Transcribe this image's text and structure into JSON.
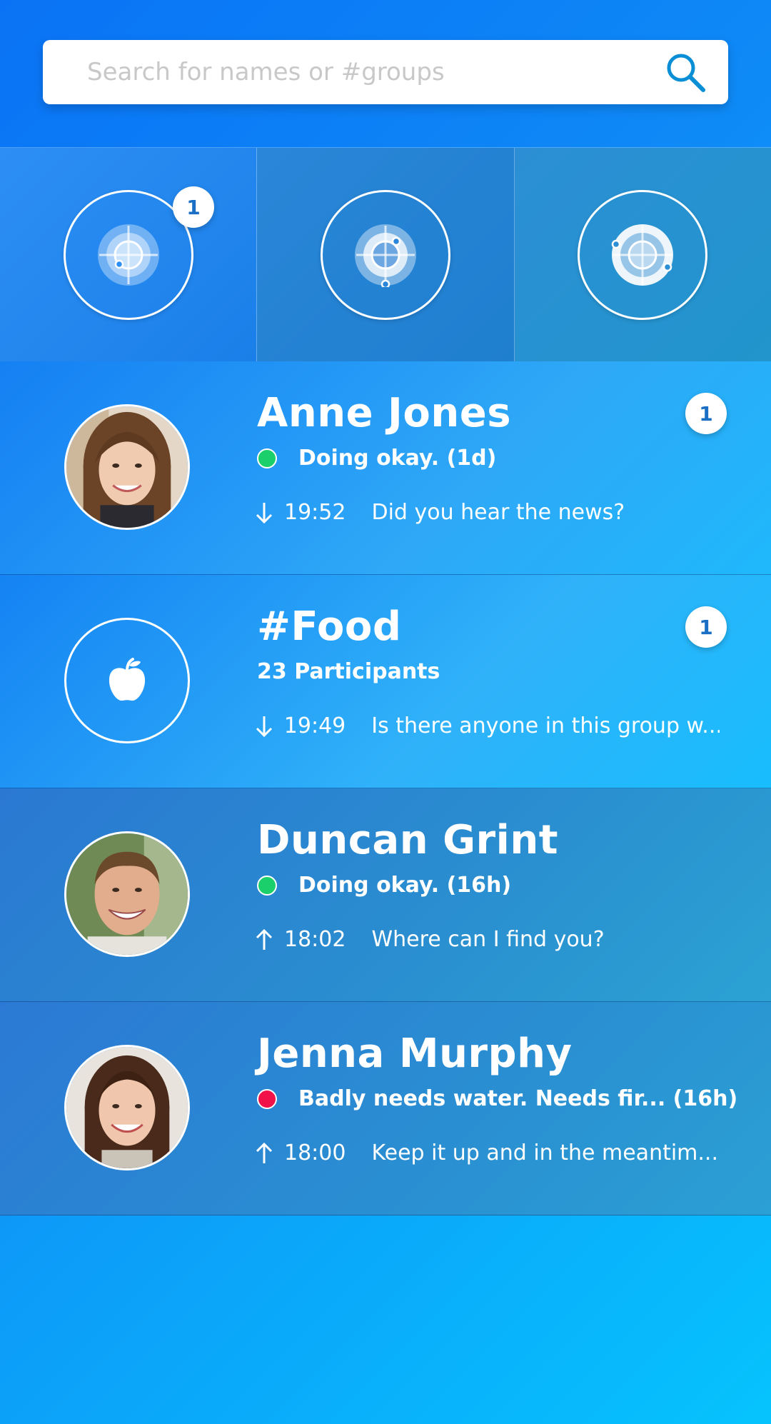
{
  "search": {
    "placeholder": "Search for names or #groups",
    "value": ""
  },
  "tabs": [
    {
      "icon": "radar-icon",
      "badge": "1",
      "active": true
    },
    {
      "icon": "radar-icon",
      "badge": ""
    },
    {
      "icon": "radar-icon",
      "badge": ""
    }
  ],
  "conversations": [
    {
      "type": "person",
      "name": "Anne Jones",
      "status_color": "#1bd06a",
      "status": "Doing okay. (1d)",
      "direction": "incoming",
      "time": "19:52",
      "preview": "Did you hear the news?",
      "badge": "1"
    },
    {
      "type": "group",
      "name": "#Food",
      "icon": "apple-icon",
      "participants": "23 Participants",
      "direction": "incoming",
      "time": "19:49",
      "preview": "Is there anyone in this group w...",
      "badge": "1"
    },
    {
      "type": "person",
      "name": "Duncan Grint",
      "status_color": "#1bd06a",
      "status": "Doing okay. (16h)",
      "direction": "outgoing",
      "time": "18:02",
      "preview": "Where can I find you?",
      "badge": ""
    },
    {
      "type": "person",
      "name": "Jenna Murphy",
      "status_color": "#f2124a",
      "status": "Badly needs water. Needs fir... (16h)",
      "direction": "outgoing",
      "time": "18:00",
      "preview": "Keep it up and in the meantim...",
      "badge": ""
    }
  ]
}
